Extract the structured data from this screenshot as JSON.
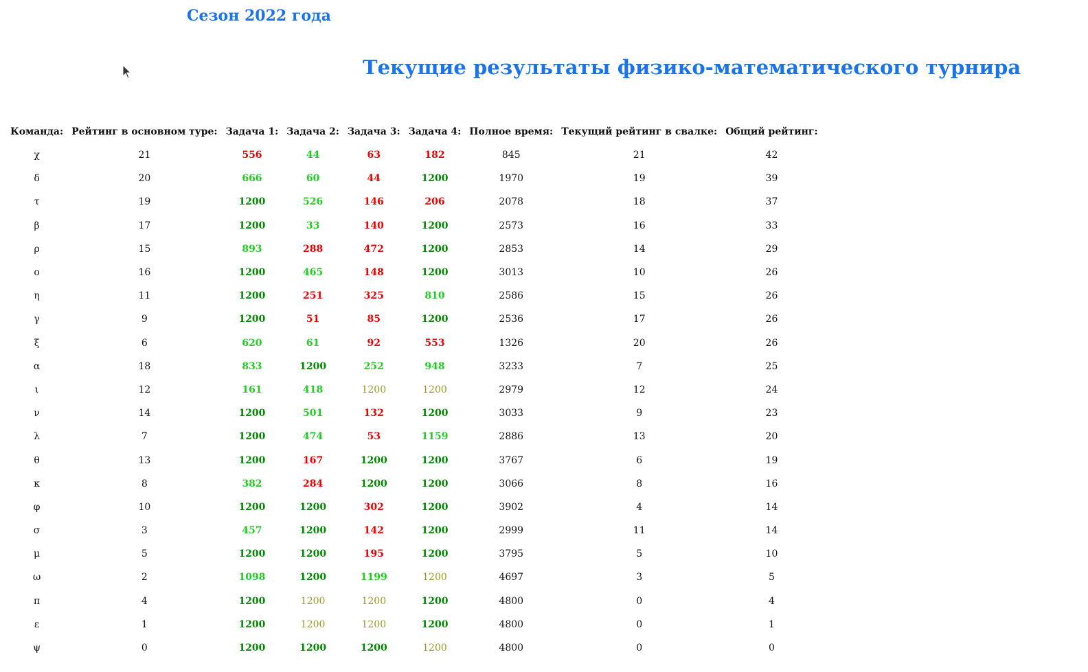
{
  "header": {
    "season_link": "Сезон 2022 года",
    "title": "Текущие результаты физико-математического турнира"
  },
  "colors": {
    "link_blue": "#1a73e8",
    "red": "#ee0000",
    "green": "#22cc22",
    "dark_green": "#008800",
    "olive": "#999922"
  },
  "table": {
    "columns": [
      "Команда:",
      "Рейтинг в основном туре:",
      "Задача 1:",
      "Задача 2:",
      "Задача 3:",
      "Задача 4:",
      "Полное время:",
      "Текущий рейтинг в свалке:",
      "Общий рейтинг:"
    ],
    "rows": [
      {
        "team": "χ",
        "main": "21",
        "t": [
          [
            "556",
            "red"
          ],
          [
            "44",
            "green"
          ],
          [
            "63",
            "red"
          ],
          [
            "182",
            "red"
          ]
        ],
        "time": "845",
        "dump": "21",
        "total": "42"
      },
      {
        "team": "δ",
        "main": "20",
        "t": [
          [
            "666",
            "green"
          ],
          [
            "60",
            "green"
          ],
          [
            "44",
            "red"
          ],
          [
            "1200",
            "dkgreen"
          ]
        ],
        "time": "1970",
        "dump": "19",
        "total": "39"
      },
      {
        "team": "τ",
        "main": "19",
        "t": [
          [
            "1200",
            "dkgreen"
          ],
          [
            "526",
            "green"
          ],
          [
            "146",
            "red"
          ],
          [
            "206",
            "red"
          ]
        ],
        "time": "2078",
        "dump": "18",
        "total": "37"
      },
      {
        "team": "β",
        "main": "17",
        "t": [
          [
            "1200",
            "dkgreen"
          ],
          [
            "33",
            "green"
          ],
          [
            "140",
            "red"
          ],
          [
            "1200",
            "dkgreen"
          ]
        ],
        "time": "2573",
        "dump": "16",
        "total": "33"
      },
      {
        "team": "ρ",
        "main": "15",
        "t": [
          [
            "893",
            "green"
          ],
          [
            "288",
            "red"
          ],
          [
            "472",
            "red"
          ],
          [
            "1200",
            "dkgreen"
          ]
        ],
        "time": "2853",
        "dump": "14",
        "total": "29"
      },
      {
        "team": "ο",
        "main": "16",
        "t": [
          [
            "1200",
            "dkgreen"
          ],
          [
            "465",
            "green"
          ],
          [
            "148",
            "red"
          ],
          [
            "1200",
            "dkgreen"
          ]
        ],
        "time": "3013",
        "dump": "10",
        "total": "26"
      },
      {
        "team": "η",
        "main": "11",
        "t": [
          [
            "1200",
            "dkgreen"
          ],
          [
            "251",
            "red"
          ],
          [
            "325",
            "red"
          ],
          [
            "810",
            "green"
          ]
        ],
        "time": "2586",
        "dump": "15",
        "total": "26"
      },
      {
        "team": "γ",
        "main": "9",
        "t": [
          [
            "1200",
            "dkgreen"
          ],
          [
            "51",
            "red"
          ],
          [
            "85",
            "red"
          ],
          [
            "1200",
            "dkgreen"
          ]
        ],
        "time": "2536",
        "dump": "17",
        "total": "26"
      },
      {
        "team": "ξ",
        "main": "6",
        "t": [
          [
            "620",
            "green"
          ],
          [
            "61",
            "green"
          ],
          [
            "92",
            "red"
          ],
          [
            "553",
            "red"
          ]
        ],
        "time": "1326",
        "dump": "20",
        "total": "26"
      },
      {
        "team": "α",
        "main": "18",
        "t": [
          [
            "833",
            "green"
          ],
          [
            "1200",
            "dkgreen"
          ],
          [
            "252",
            "green"
          ],
          [
            "948",
            "green"
          ]
        ],
        "time": "3233",
        "dump": "7",
        "total": "25"
      },
      {
        "team": "ι",
        "main": "12",
        "t": [
          [
            "161",
            "green"
          ],
          [
            "418",
            "green"
          ],
          [
            "1200",
            "olive"
          ],
          [
            "1200",
            "olive"
          ]
        ],
        "time": "2979",
        "dump": "12",
        "total": "24"
      },
      {
        "team": "ν",
        "main": "14",
        "t": [
          [
            "1200",
            "dkgreen"
          ],
          [
            "501",
            "green"
          ],
          [
            "132",
            "red"
          ],
          [
            "1200",
            "dkgreen"
          ]
        ],
        "time": "3033",
        "dump": "9",
        "total": "23"
      },
      {
        "team": "λ",
        "main": "7",
        "t": [
          [
            "1200",
            "dkgreen"
          ],
          [
            "474",
            "green"
          ],
          [
            "53",
            "red"
          ],
          [
            "1159",
            "green"
          ]
        ],
        "time": "2886",
        "dump": "13",
        "total": "20"
      },
      {
        "team": "θ",
        "main": "13",
        "t": [
          [
            "1200",
            "dkgreen"
          ],
          [
            "167",
            "red"
          ],
          [
            "1200",
            "dkgreen"
          ],
          [
            "1200",
            "dkgreen"
          ]
        ],
        "time": "3767",
        "dump": "6",
        "total": "19"
      },
      {
        "team": "κ",
        "main": "8",
        "t": [
          [
            "382",
            "green"
          ],
          [
            "284",
            "red"
          ],
          [
            "1200",
            "dkgreen"
          ],
          [
            "1200",
            "dkgreen"
          ]
        ],
        "time": "3066",
        "dump": "8",
        "total": "16"
      },
      {
        "team": "φ",
        "main": "10",
        "t": [
          [
            "1200",
            "dkgreen"
          ],
          [
            "1200",
            "dkgreen"
          ],
          [
            "302",
            "red"
          ],
          [
            "1200",
            "dkgreen"
          ]
        ],
        "time": "3902",
        "dump": "4",
        "total": "14"
      },
      {
        "team": "σ",
        "main": "3",
        "t": [
          [
            "457",
            "green"
          ],
          [
            "1200",
            "dkgreen"
          ],
          [
            "142",
            "red"
          ],
          [
            "1200",
            "dkgreen"
          ]
        ],
        "time": "2999",
        "dump": "11",
        "total": "14"
      },
      {
        "team": "μ",
        "main": "5",
        "t": [
          [
            "1200",
            "dkgreen"
          ],
          [
            "1200",
            "dkgreen"
          ],
          [
            "195",
            "red"
          ],
          [
            "1200",
            "dkgreen"
          ]
        ],
        "time": "3795",
        "dump": "5",
        "total": "10"
      },
      {
        "team": "ω",
        "main": "2",
        "t": [
          [
            "1098",
            "green"
          ],
          [
            "1200",
            "dkgreen"
          ],
          [
            "1199",
            "green"
          ],
          [
            "1200",
            "olive"
          ]
        ],
        "time": "4697",
        "dump": "3",
        "total": "5"
      },
      {
        "team": "π",
        "main": "4",
        "t": [
          [
            "1200",
            "dkgreen"
          ],
          [
            "1200",
            "olive"
          ],
          [
            "1200",
            "olive"
          ],
          [
            "1200",
            "dkgreen"
          ]
        ],
        "time": "4800",
        "dump": "0",
        "total": "4"
      },
      {
        "team": "ε",
        "main": "1",
        "t": [
          [
            "1200",
            "dkgreen"
          ],
          [
            "1200",
            "olive"
          ],
          [
            "1200",
            "olive"
          ],
          [
            "1200",
            "dkgreen"
          ]
        ],
        "time": "4800",
        "dump": "0",
        "total": "1"
      },
      {
        "team": "ψ",
        "main": "0",
        "t": [
          [
            "1200",
            "dkgreen"
          ],
          [
            "1200",
            "dkgreen"
          ],
          [
            "1200",
            "dkgreen"
          ],
          [
            "1200",
            "olive"
          ]
        ],
        "time": "4800",
        "dump": "0",
        "total": "0"
      }
    ]
  }
}
